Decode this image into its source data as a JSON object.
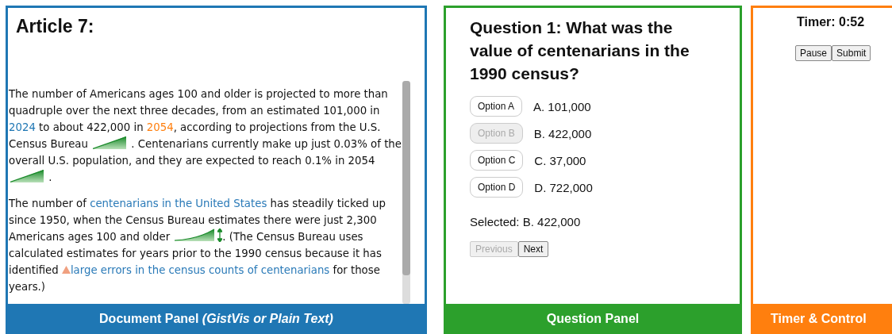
{
  "document_panel": {
    "title": "Article 7:",
    "paragraphs": [
      [
        {
          "kind": "text",
          "text": "The number of Americans ages 100 and older is projected to more than quadruple over the next three decades, from an estimated 101,000 in "
        },
        {
          "kind": "highlight",
          "text": "2024",
          "color": "#1f77b4"
        },
        {
          "kind": "text",
          "text": " to about 422,000 in "
        },
        {
          "kind": "highlight",
          "text": "2054",
          "color": "#ff7f0e"
        },
        {
          "kind": "text",
          "text": ", according to projections from the U.S. Census Bureau "
        },
        {
          "kind": "sparkline"
        },
        {
          "kind": "text",
          "text": " .  Centenarians currently make up just 0.03% of the overall U.S. population, and they are expected to reach 0.1% in 2054 "
        },
        {
          "kind": "sparkline"
        },
        {
          "kind": "text",
          "text": " ."
        }
      ],
      [
        {
          "kind": "text",
          "text": "The number of "
        },
        {
          "kind": "link",
          "text": "centenarians in the United States"
        },
        {
          "kind": "text",
          "text": " has steadily ticked up since 1950, when the Census Bureau estimates there were just 2,300 Americans ages 100 and older "
        },
        {
          "kind": "curve-sparkline"
        },
        {
          "kind": "text",
          "text": ". (The Census Bureau uses calculated estimates for years prior to the 1990 census because it has identified "
        },
        {
          "kind": "warning-link",
          "text": "large errors in the census counts of centenarians"
        },
        {
          "kind": "text",
          "text": " for those years.)"
        }
      ]
    ],
    "footer": "**Document Panel** *(GistVis or Plain Text)*"
  },
  "question_panel": {
    "title": "Question 1: What was the value of centenarians in the 1990 census?",
    "options": [
      {
        "button": "Option A",
        "answer": "A. 101,000",
        "selected": false
      },
      {
        "button": "Option B",
        "answer": "B. 422,000",
        "selected": true
      },
      {
        "button": "Option C",
        "answer": "C. 37,000",
        "selected": false
      },
      {
        "button": "Option D",
        "answer": "D. 722,000",
        "selected": false
      }
    ],
    "selection": "Selected: B. 422,000",
    "navigation": [
      {
        "label": "Previous",
        "disabled": true
      },
      {
        "label": "Next",
        "disabled": false
      }
    ],
    "footer": "Question Panel"
  },
  "timer_panel": {
    "timer": "Timer: 0:52",
    "buttons": [
      "Pause",
      "Submit"
    ],
    "footer": "Timer & Control"
  }
}
